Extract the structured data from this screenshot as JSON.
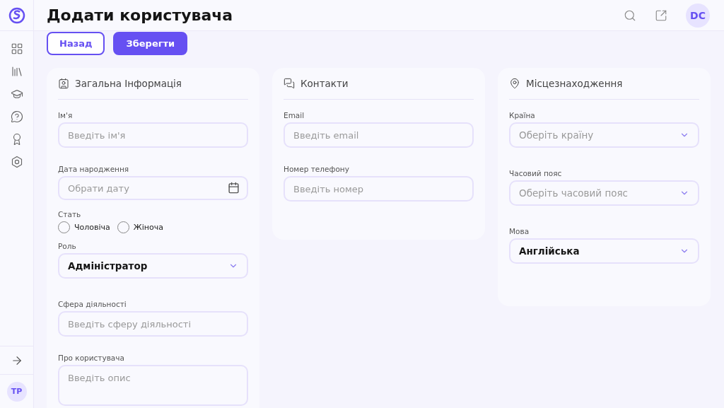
{
  "header": {
    "title": "Додати користувача",
    "user_initials": "DC"
  },
  "sidebar": {
    "user_initials": "TP"
  },
  "buttons": [
    {
      "label": "Назад",
      "kind": "outline"
    },
    {
      "label": "Зберегти",
      "kind": "primary"
    }
  ],
  "cards": [
    {
      "title": "Загальна Інформація",
      "fields": [
        {
          "kind": "input",
          "label": "Ім'я",
          "placeholder": "Введіть ім'я"
        },
        {
          "kind": "date",
          "label": "Дата народження",
          "placeholder": "Обрати дату"
        },
        {
          "kind": "radio",
          "label": "Стать",
          "options": [
            {
              "label": "Чоловіча",
              "selected": false
            },
            {
              "label": "Жіноча",
              "selected": false
            }
          ]
        },
        {
          "kind": "select",
          "label": "Роль",
          "value": "Адміністратор"
        },
        {
          "kind": "input",
          "label": "Сфера діяльності",
          "placeholder": "Введіть сферу діяльності"
        },
        {
          "kind": "textarea",
          "label": "Про користувача",
          "placeholder": "Введіть опис"
        }
      ]
    },
    {
      "title": "Контакти",
      "fields": [
        {
          "kind": "input",
          "label": "Email",
          "placeholder": "Введіть email"
        },
        {
          "kind": "input",
          "label": "Номер телефону",
          "placeholder": "Введіть номер"
        }
      ]
    },
    {
      "title": "Місцезнаходження",
      "fields": [
        {
          "kind": "select",
          "label": "Країна",
          "placeholder": "Оберіть країну"
        },
        {
          "kind": "select",
          "label": "Часовий пояс",
          "placeholder": "Оберіть часовий пояс"
        },
        {
          "kind": "select",
          "label": "Мова",
          "value": "Англійська"
        }
      ]
    }
  ]
}
